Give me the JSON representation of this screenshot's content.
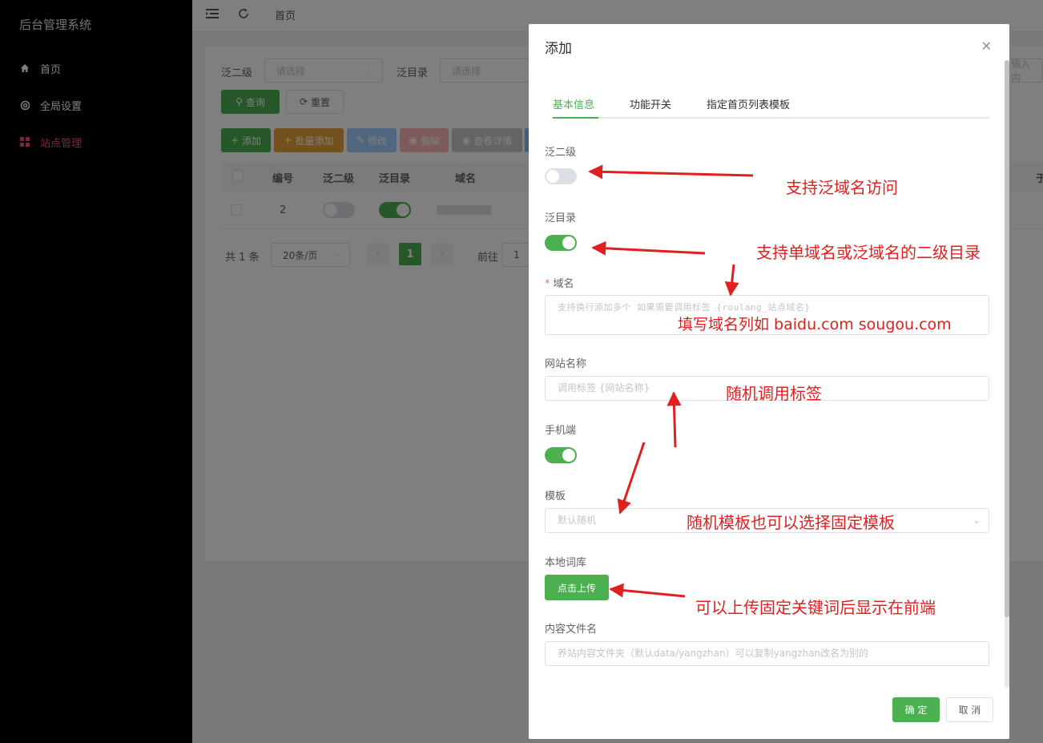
{
  "sidebar": {
    "title": "后台管理系统",
    "items": [
      {
        "label": "首页",
        "active": false
      },
      {
        "label": "全局设置",
        "active": false
      },
      {
        "label": "站点管理",
        "active": true
      }
    ]
  },
  "topbar": {
    "breadcrumb": "首页"
  },
  "filters": {
    "fan_second_label": "泛二级",
    "fan_second_placeholder": "请选择",
    "fan_dir_label": "泛目录",
    "fan_dir_placeholder": "请选择",
    "domain_placeholder_partial": "输入内"
  },
  "buttons": {
    "query": "查询",
    "reset": "重置",
    "add": "添加",
    "batch_add": "批量添加",
    "edit": "修改",
    "delete": "删除",
    "view_detail": "查看详情"
  },
  "table": {
    "columns": [
      "编号",
      "泛二级",
      "泛目录",
      "域名"
    ],
    "extra_col_partial": "于",
    "rows": [
      {
        "id": "2",
        "fan_second": false,
        "fan_dir": true,
        "domain": ""
      }
    ]
  },
  "pagination": {
    "total": "共 1 条",
    "page_size": "20条/页",
    "current": "1",
    "goto_label": "前往",
    "goto_value": "1"
  },
  "modal": {
    "title": "添加",
    "tabs": [
      {
        "label": "基本信息",
        "active": true
      },
      {
        "label": "功能开关",
        "active": false
      },
      {
        "label": "指定首页列表模板",
        "active": false
      }
    ],
    "fields": {
      "fan_second_label": "泛二级",
      "fan_second_on": false,
      "fan_dir_label": "泛目录",
      "fan_dir_on": true,
      "domain_label": "域名",
      "domain_placeholder": "支持换行添加多个  如果需要调用标签 {roulang_站点域名}",
      "site_name_label": "网站名称",
      "site_name_placeholder": "调用标签 {网站名称}",
      "mobile_label": "手机端",
      "mobile_on": true,
      "template_label": "模板",
      "template_placeholder": "默认随机",
      "local_lexicon_label": "本地词库",
      "upload_button": "点击上传",
      "content_file_label": "内容文件名",
      "content_file_placeholder": "养站内容文件夹（默认data/yangzhan）可以复制yangzhan改名为别的"
    },
    "confirm": "确 定",
    "cancel": "取 消"
  },
  "annotations": {
    "a1": "支持泛域名访问",
    "a2": "支持单域名或泛域名的二级目录",
    "a3": "填写域名列如 baidu.com sougou.com",
    "a4": "随机调用标签",
    "a5": "随机模板也可以选择固定模板",
    "a6": "可以上传固定关键词后显示在前端"
  },
  "colors": {
    "primary_green": "#4caf50",
    "orange": "#e6a23c",
    "sidebar_active": "#ff4d6d",
    "annotation_red": "#e02020"
  }
}
